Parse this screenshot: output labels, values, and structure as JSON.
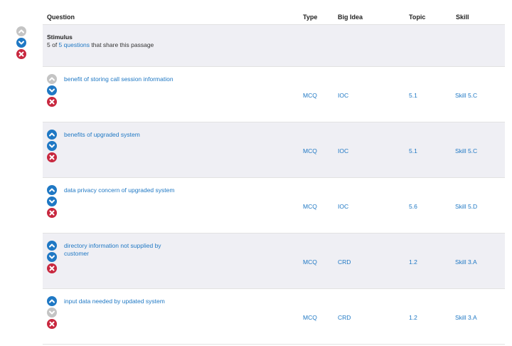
{
  "headers": {
    "question": "Question",
    "type": "Type",
    "big_idea": "Big Idea",
    "topic": "Topic",
    "skill": "Skill"
  },
  "stimulus": {
    "title": "Stimulus",
    "prefix": "5 of ",
    "link": "5 questions",
    "suffix": " that share this passage",
    "controls": {
      "up": "disabled",
      "down": "enabled",
      "remove": "enabled"
    }
  },
  "questions": [
    {
      "text": "benefit of storing call session information",
      "type": "MCQ",
      "big_idea": "IOC",
      "topic": "5.1",
      "skill": "Skill 5.C",
      "up": "disabled",
      "down": "enabled"
    },
    {
      "text": "benefits of upgraded system",
      "type": "MCQ",
      "big_idea": "IOC",
      "topic": "5.1",
      "skill": "Skill 5.C",
      "up": "enabled",
      "down": "enabled"
    },
    {
      "text": "data privacy concern of upgraded system",
      "type": "MCQ",
      "big_idea": "IOC",
      "topic": "5.6",
      "skill": "Skill 5.D",
      "up": "enabled",
      "down": "enabled"
    },
    {
      "text": "directory information not supplied by customer",
      "type": "MCQ",
      "big_idea": "CRD",
      "topic": "1.2",
      "skill": "Skill 3.A",
      "up": "enabled",
      "down": "enabled"
    },
    {
      "text": "input data needed by updated system",
      "type": "MCQ",
      "big_idea": "CRD",
      "topic": "1.2",
      "skill": "Skill 3.A",
      "up": "enabled",
      "down": "disabled"
    }
  ],
  "colors": {
    "blue": "#1f78c4",
    "gray": "#c4c4c4",
    "red": "#c8283f",
    "row_shade": "#efeff4"
  },
  "icons": {
    "up": "chevron-up-icon",
    "down": "chevron-down-icon",
    "remove": "close-icon"
  }
}
